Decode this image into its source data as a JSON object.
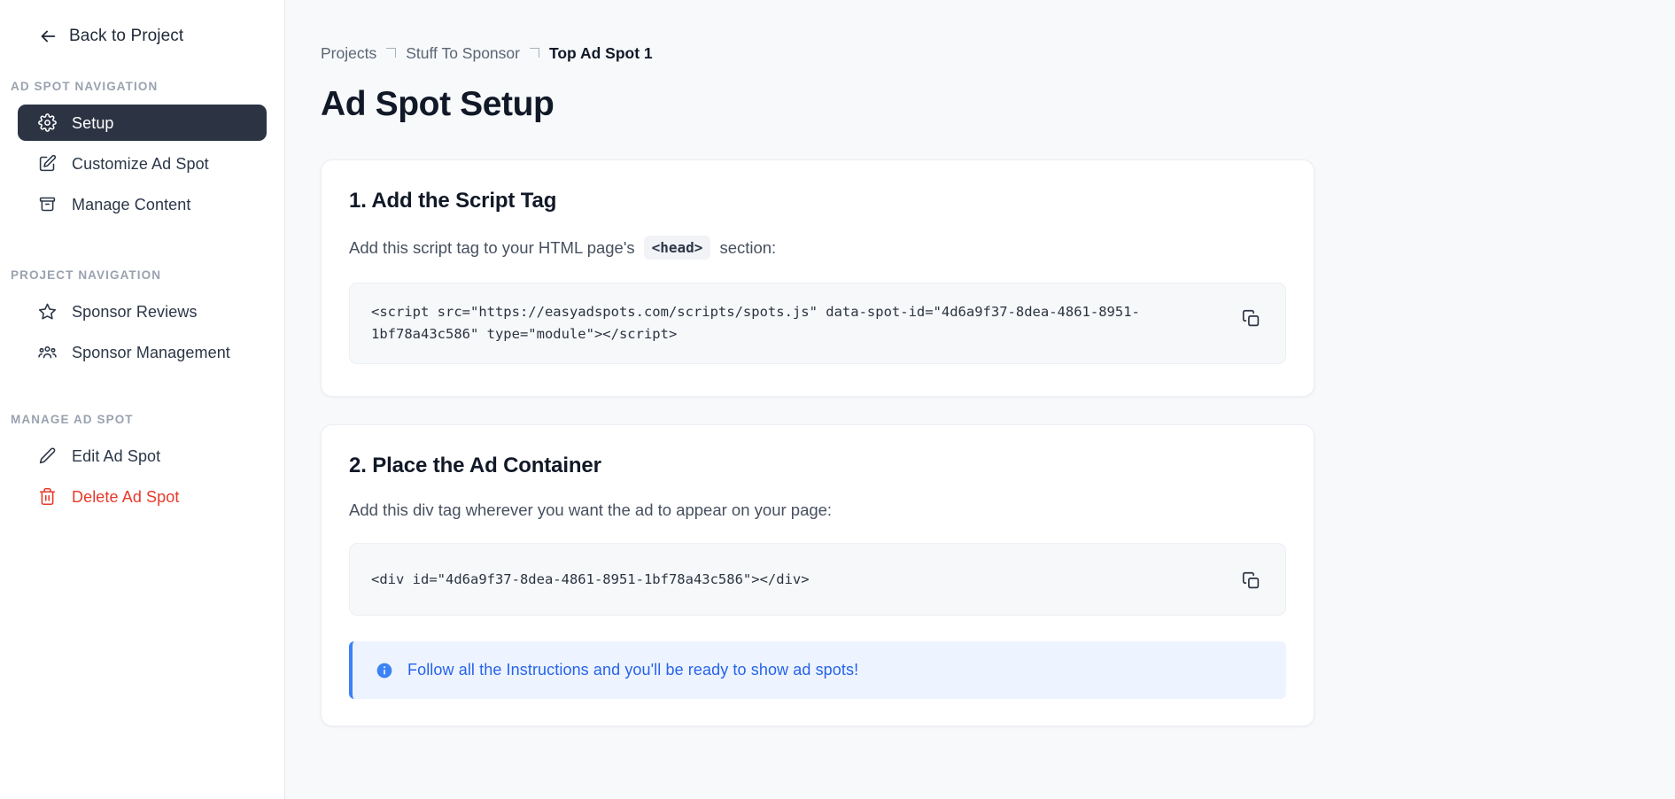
{
  "sidebar": {
    "back": {
      "label": "Back to Project",
      "icon": "arrow-left-icon"
    },
    "groups": [
      {
        "title": "AD SPOT NAVIGATION",
        "items": [
          {
            "label": "Setup",
            "icon": "gear-icon",
            "active": true
          },
          {
            "label": "Customize Ad Spot",
            "icon": "edit-square-icon",
            "active": false
          },
          {
            "label": "Manage Content",
            "icon": "archive-box-icon",
            "active": false
          }
        ]
      },
      {
        "title": "PROJECT NAVIGATION",
        "items": [
          {
            "label": "Sponsor Reviews",
            "icon": "star-icon",
            "active": false
          },
          {
            "label": "Sponsor Management",
            "icon": "users-group-icon",
            "active": false
          }
        ]
      },
      {
        "title": "MANAGE AD SPOT",
        "items": [
          {
            "label": "Edit Ad Spot",
            "icon": "pencil-icon",
            "active": false
          },
          {
            "label": "Delete Ad Spot",
            "icon": "trash-icon",
            "active": false,
            "danger": true
          }
        ]
      }
    ]
  },
  "breadcrumb": {
    "items": [
      {
        "label": "Projects",
        "current": false
      },
      {
        "label": "Stuff To Sponsor",
        "current": false
      },
      {
        "label": "Top Ad Spot 1",
        "current": true
      }
    ],
    "separator_icon": "chevron-corner-icon"
  },
  "page": {
    "title": "Ad Spot Setup"
  },
  "steps": [
    {
      "title": "1. Add the Script Tag",
      "desc_before": "Add this script tag to your HTML page's",
      "inline_code": "<head>",
      "desc_after": "section:",
      "code": "<script src=\"https://easyadspots.com/scripts/spots.js\" data-spot-id=\"4d6a9f37-8dea-4861-8951-1bf78a43c586\" type=\"module\"></script>",
      "copy_icon": "copy-icon"
    },
    {
      "title": "2. Place the Ad Container",
      "desc": "Add this div tag wherever you want the ad to appear on your page:",
      "code": "<div id=\"4d6a9f37-8dea-4861-8951-1bf78a43c586\"></div>",
      "copy_icon": "copy-icon"
    }
  ],
  "info_banner": {
    "icon": "info-circle-icon",
    "text": "Follow all the Instructions and you'll be ready to show ad spots!",
    "accent_color": "#3b82f6",
    "background_color": "#eef4ff"
  },
  "colors": {
    "active_nav_background": "#2c3444",
    "danger": "#e8392a",
    "page_background": "#f7f9fb",
    "card_background": "#ffffff",
    "code_background": "#f6f8fa",
    "heading": "#111827"
  }
}
